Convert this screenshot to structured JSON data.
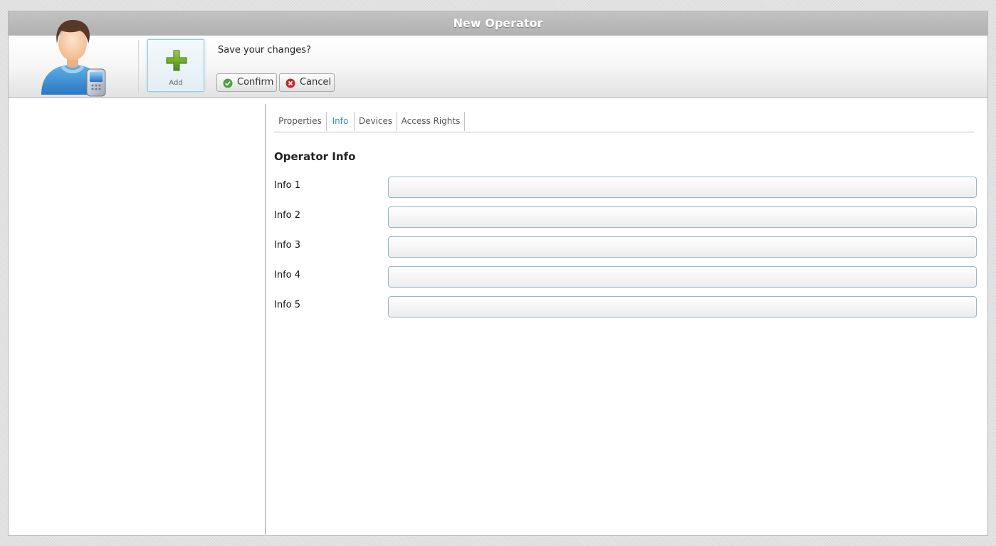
{
  "window": {
    "title": "New Operator"
  },
  "toolbar": {
    "add_label": "Add",
    "prompt": "Save your changes?",
    "confirm_label": "Confirm",
    "cancel_label": "Cancel"
  },
  "tabs": [
    {
      "label": "Properties",
      "active": false
    },
    {
      "label": "Info",
      "active": true
    },
    {
      "label": "Devices",
      "active": false
    },
    {
      "label": "Access Rights",
      "active": false
    }
  ],
  "section": {
    "title": "Operator Info"
  },
  "fields": [
    {
      "label": "Info 1",
      "value": ""
    },
    {
      "label": "Info 2",
      "value": ""
    },
    {
      "label": "Info 3",
      "value": ""
    },
    {
      "label": "Info 4",
      "value": ""
    },
    {
      "label": "Info 5",
      "value": ""
    }
  ],
  "colors": {
    "titlebar": "#b5b5b5",
    "active_tab": "#3a8ac0",
    "add_icon": "#5a9a1e",
    "confirm_icon": "#4aa23a",
    "cancel_icon": "#c0282e"
  },
  "icons": {
    "avatar": "operator-avatar-with-phone",
    "add": "green-plus-icon",
    "confirm": "check-circle-icon",
    "cancel": "x-circle-icon"
  }
}
